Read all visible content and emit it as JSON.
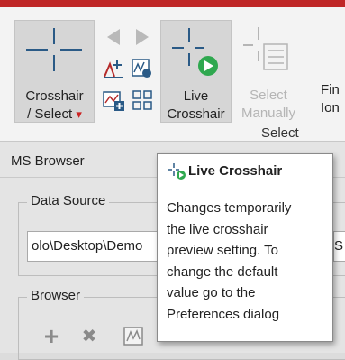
{
  "ribbon": {
    "crosshair_select": {
      "line1": "Crosshair",
      "line2": "/ Select",
      "dropdown": "▾"
    },
    "live_crosshair": {
      "line1": "Live",
      "line2": "Crosshair"
    },
    "select_manually": {
      "line1": "Select",
      "line2": "Manually"
    },
    "find_ions_cutoff": {
      "line1": "Fin",
      "line2": "Ion"
    },
    "group_label": "Select",
    "icons": {
      "crosshair": "crosshair-icon",
      "live_crosshair": "live-crosshair-icon",
      "select_manually": "select-manually-icon",
      "back": "arrow-left-icon",
      "forward": "arrow-right-icon"
    }
  },
  "ms_browser": {
    "title": "MS Browser",
    "data_source": {
      "legend": "Data Source",
      "path_value": "olo\\Desktop\\Demo",
      "right_field_value": "S"
    },
    "browser": {
      "legend": "Browser",
      "toolbar": {
        "add": "+",
        "remove": "✖"
      }
    }
  },
  "tooltip": {
    "title": "Live Crosshair",
    "body_lines": [
      "Changes temporarily",
      "the live crosshair",
      "preview setting. To",
      "change the default",
      "value go to the",
      "Preferences dialog"
    ]
  },
  "colors": {
    "title_bar": "#bf2626",
    "icon_blue": "#2a5a86",
    "play_green": "#2fa84f",
    "dropdown_red": "#cc2222"
  }
}
